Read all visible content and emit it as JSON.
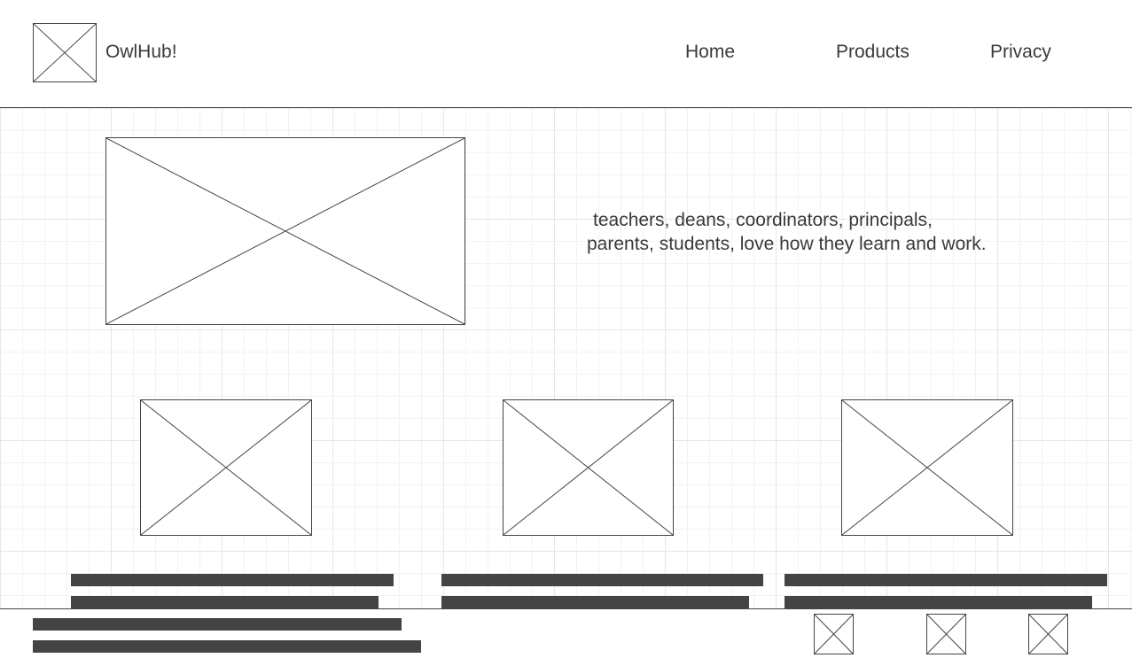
{
  "header": {
    "logo_icon": "image-placeholder-icon",
    "brand": "OwlHub!",
    "nav": [
      {
        "label": "Home"
      },
      {
        "label": "Products"
      },
      {
        "label": "Privacy"
      }
    ]
  },
  "hero": {
    "image_icon": "image-placeholder-icon",
    "tagline_line1": "teachers, deans, coordinators, principals,",
    "tagline_line2": "parents, students, love how they learn and work."
  },
  "features": [
    {
      "image_icon": "image-placeholder-icon",
      "text_lines": 2
    },
    {
      "image_icon": "image-placeholder-icon",
      "text_lines": 2
    },
    {
      "image_icon": "image-placeholder-icon",
      "text_lines": 2
    }
  ],
  "footer": {
    "text_lines": 2,
    "social_icons": [
      "image-placeholder-icon",
      "image-placeholder-icon",
      "image-placeholder-icon"
    ]
  },
  "colors": {
    "line": "#444444",
    "text": "#3a3a3a",
    "grid_major": "#e6e6e6",
    "grid_minor": "#f2f2f2"
  }
}
